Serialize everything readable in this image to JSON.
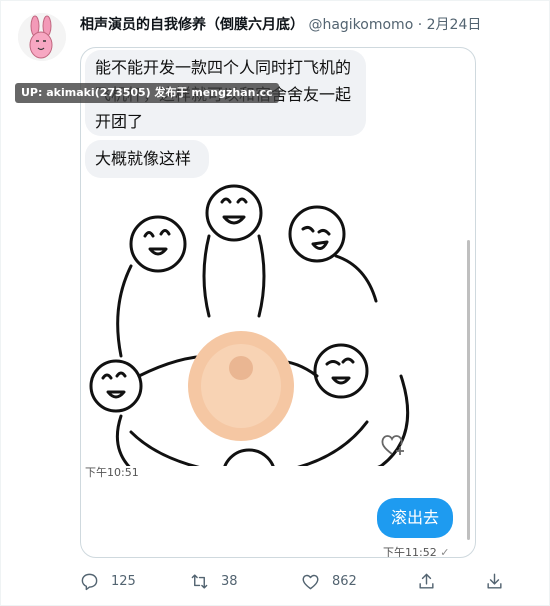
{
  "tweet": {
    "display_name": "相声演员的自我修养（倒膜六月底）",
    "handle": "@hagikomomo",
    "separator": "·",
    "date": "2月24日"
  },
  "watermark": "UP: akimaki(273505) 发布于 mengzhan.cc",
  "chat": {
    "message1": "能不能开发一款四个人同时打飞机的飞机杯，这样就可以和宿舍舍友一起开团了",
    "message2": "大概就像这样",
    "time1": "下午10:51",
    "reply": "滚出去",
    "time2": "下午11:52",
    "read_mark": "✓"
  },
  "actions": {
    "replies": "125",
    "retweets": "38",
    "likes": "862"
  },
  "colors": {
    "accent": "#1d9bf0",
    "bubble_in": "#f0f2f5",
    "muted": "#536471"
  },
  "icons": [
    "avatar-rabbit",
    "heart-plus-icon",
    "reply-icon",
    "retweet-icon",
    "like-icon",
    "share-icon",
    "download-icon"
  ]
}
